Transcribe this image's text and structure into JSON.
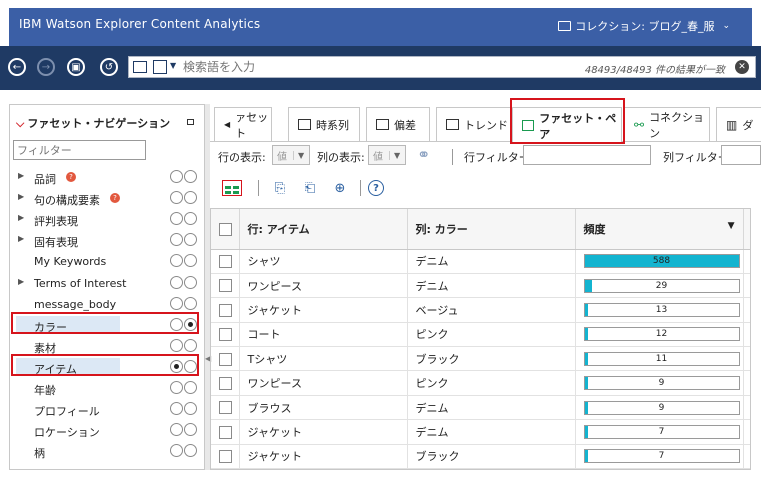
{
  "header": {
    "app_title": "IBM Watson Explorer Content Analytics",
    "collection_label": "コレクション: ブログ_春_服"
  },
  "search": {
    "placeholder": "検索語を入力",
    "result_count": "48493/48493 件の結果が一致"
  },
  "left_panel": {
    "title": "ファセット・ナビゲーション",
    "filter_placeholder": "フィルター",
    "facets": [
      {
        "label": "品詞",
        "expandable": true,
        "info": true,
        "row_selected": false,
        "col_selected": false
      },
      {
        "label": "句の構成要素",
        "expandable": true,
        "info": true,
        "row_selected": false,
        "col_selected": false
      },
      {
        "label": "評判表現",
        "expandable": true,
        "info": false,
        "row_selected": false,
        "col_selected": false
      },
      {
        "label": "固有表現",
        "expandable": true,
        "info": false,
        "row_selected": false,
        "col_selected": false
      },
      {
        "label": "My Keywords",
        "expandable": false,
        "info": false,
        "row_selected": false,
        "col_selected": false
      },
      {
        "label": "Terms of Interest",
        "expandable": true,
        "info": false,
        "row_selected": false,
        "col_selected": false
      },
      {
        "label": "message_body",
        "expandable": false,
        "info": false,
        "row_selected": false,
        "col_selected": false
      },
      {
        "label": "カラー",
        "expandable": false,
        "info": false,
        "row_selected": false,
        "col_selected": true
      },
      {
        "label": "素材",
        "expandable": false,
        "info": false,
        "row_selected": false,
        "col_selected": false
      },
      {
        "label": "アイテム",
        "expandable": false,
        "info": false,
        "row_selected": true,
        "col_selected": false
      },
      {
        "label": "年齢",
        "expandable": false,
        "info": false,
        "row_selected": false,
        "col_selected": false
      },
      {
        "label": "プロフィール",
        "expandable": false,
        "info": false,
        "row_selected": false,
        "col_selected": false
      },
      {
        "label": "ロケーション",
        "expandable": false,
        "info": false,
        "row_selected": false,
        "col_selected": false
      },
      {
        "label": "柄",
        "expandable": false,
        "info": false,
        "row_selected": false,
        "col_selected": false
      }
    ]
  },
  "tabs": [
    {
      "label": "ァセット",
      "icon": "tab-scroll-left-icon"
    },
    {
      "label": "時系列",
      "icon": "time-series-icon"
    },
    {
      "label": "偏差",
      "icon": "deviation-icon"
    },
    {
      "label": "トレンド",
      "icon": "trend-icon"
    },
    {
      "label": "ファセット・ペア",
      "icon": "facet-pair-icon",
      "active": true
    },
    {
      "label": "コネクション",
      "icon": "connection-icon"
    },
    {
      "label": "ダ",
      "icon": "dashboard-icon"
    }
  ],
  "controls": {
    "row_display_label": "行の表示:",
    "row_display_value": "値",
    "col_display_label": "列の表示:",
    "col_display_value": "値",
    "row_filter_label": "行フィルター:",
    "col_filter_label": "列フィルター:"
  },
  "table": {
    "headers": [
      "行: アイテム",
      "列: カラー",
      "頻度"
    ],
    "max_value": 588,
    "rows": [
      {
        "item": "シャツ",
        "color": "デニム",
        "freq": 588
      },
      {
        "item": "ワンピース",
        "color": "デニム",
        "freq": 29
      },
      {
        "item": "ジャケット",
        "color": "ベージュ",
        "freq": 13
      },
      {
        "item": "コート",
        "color": "ピンク",
        "freq": 12
      },
      {
        "item": "Tシャツ",
        "color": "ブラック",
        "freq": 11
      },
      {
        "item": "ワンピース",
        "color": "ピンク",
        "freq": 9
      },
      {
        "item": "ブラウス",
        "color": "デニム",
        "freq": 9
      },
      {
        "item": "ジャケット",
        "color": "デニム",
        "freq": 7
      },
      {
        "item": "ジャケット",
        "color": "ブラック",
        "freq": 7
      }
    ]
  },
  "colors": {
    "header_bg": "#3b5fa6",
    "navbar_bg": "#1f3a64",
    "bar_fill": "#13b4d0",
    "highlight_red": "#d6141c"
  }
}
